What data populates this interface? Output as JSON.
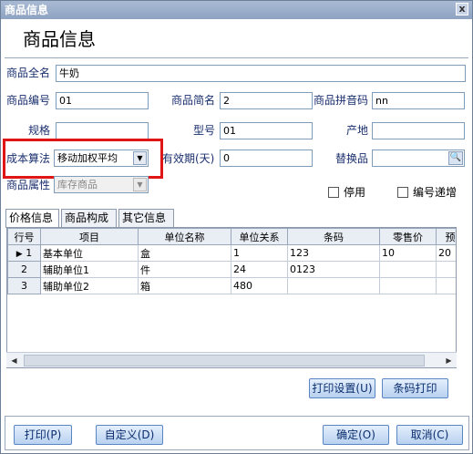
{
  "window": {
    "title": "商品信息",
    "close_label": "x"
  },
  "heading": "商品信息",
  "form": {
    "full_name_label": "商品全名",
    "full_name_value": "牛奶",
    "code_label": "商品编号",
    "code_value": "01",
    "short_name_label": "商品简名",
    "short_name_value": "2",
    "pinyin_label": "商品拼音码",
    "pinyin_value": "nn",
    "spec_label": "规格",
    "spec_value": "",
    "model_label": "型号",
    "model_value": "01",
    "origin_label": "产地",
    "origin_value": "",
    "cost_method_label": "成本算法",
    "cost_method_value": "移动加权平均",
    "shelf_life_label": "有效期(天)",
    "shelf_life_value": "0",
    "substitute_label": "替换品",
    "substitute_value": "",
    "attribute_label": "商品属性",
    "attribute_value": "库存商品",
    "disable_label": "停用",
    "code_increment_label": "编号递增"
  },
  "tabs": [
    "价格信息",
    "商品构成",
    "其它信息"
  ],
  "grid": {
    "columns": [
      "行号",
      "项目",
      "单位名称",
      "单位关系",
      "条码",
      "零售价",
      "预设"
    ],
    "rows": [
      [
        "1",
        "基本单位",
        "盒",
        "1",
        "123",
        "10",
        "20"
      ],
      [
        "2",
        "辅助单位1",
        "件",
        "24",
        "0123",
        "",
        ""
      ],
      [
        "3",
        "辅助单位2",
        "箱",
        "480",
        "",
        "",
        ""
      ]
    ]
  },
  "buttons": {
    "print_settings": "打印设置(U)",
    "barcode_print": "条码打印",
    "print": "打印(P)",
    "customize": "自定义(D)",
    "confirm": "确定(O)",
    "cancel": "取消(C)"
  },
  "colors": {
    "highlight_border": "#e01616",
    "label_blue": "#1a2f6e",
    "button_text": "#0b2d6e"
  }
}
